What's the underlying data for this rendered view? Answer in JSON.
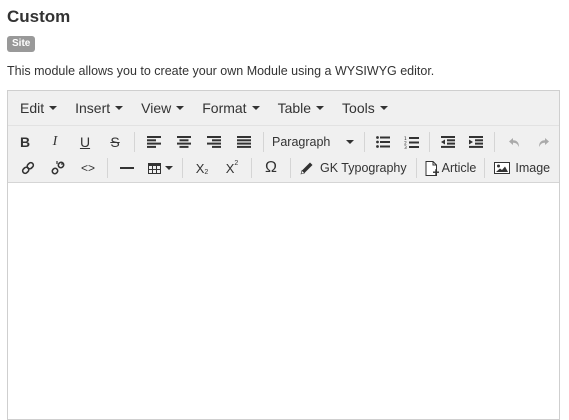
{
  "page": {
    "title": "Custom",
    "badge": "Site",
    "description": "This module allows you to create your own Module using a WYSIWYG editor."
  },
  "menubar": {
    "items": [
      {
        "label": "Edit"
      },
      {
        "label": "Insert"
      },
      {
        "label": "View"
      },
      {
        "label": "Format"
      },
      {
        "label": "Table"
      },
      {
        "label": "Tools"
      }
    ]
  },
  "toolbar": {
    "bold": "B",
    "italic": "I",
    "underline": "U",
    "strikethrough": "S",
    "format_select": "Paragraph",
    "code": "<>",
    "omega": "Ω",
    "gk_typography": "GK Typography",
    "article": "Article",
    "image": "Image",
    "subscript_main": "X",
    "subscript_small": "2",
    "superscript_main": "X",
    "superscript_small": "2"
  },
  "editor": {
    "content": ""
  }
}
